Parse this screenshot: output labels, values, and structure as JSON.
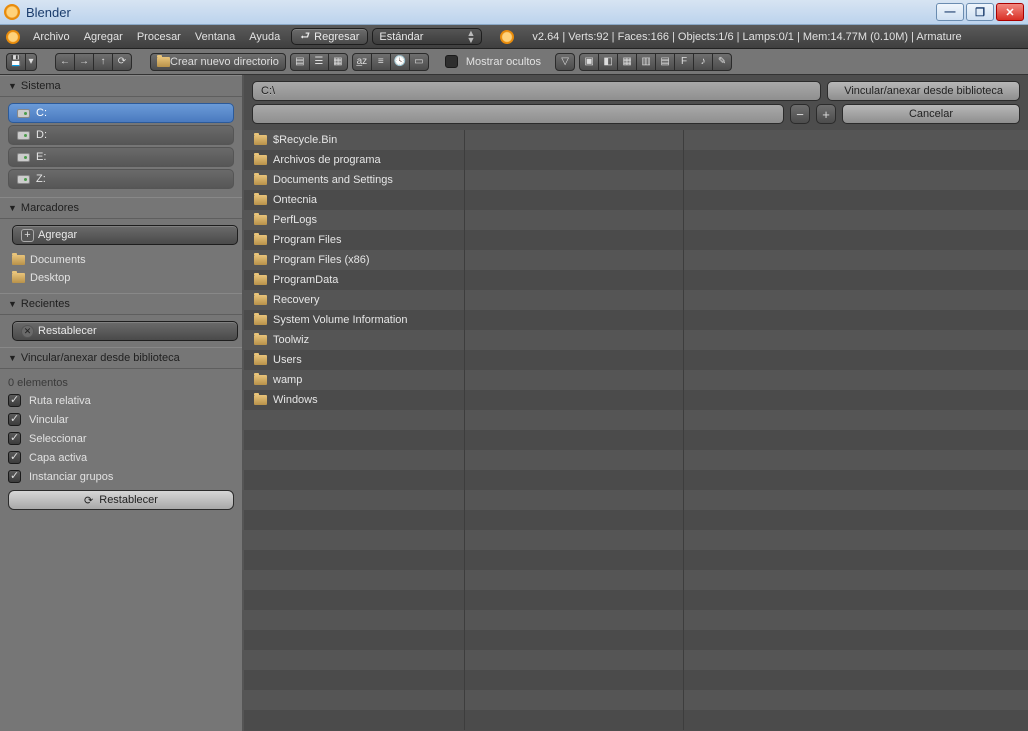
{
  "title": "Blender",
  "menus": [
    "Archivo",
    "Agregar",
    "Procesar",
    "Ventana",
    "Ayuda"
  ],
  "back_btn": "Regresar",
  "layout_dropdown": "Estándar",
  "status": "v2.64 | Verts:92 | Faces:166 | Objects:1/6 | Lamps:0/1 | Mem:14.77M (0.10M) | Armature",
  "toolbar": {
    "new_dir": "Crear nuevo directorio",
    "show_hidden": "Mostrar ocultos"
  },
  "path": "C:\\",
  "filename": "",
  "action_btn": "Vincular/anexar desde biblioteca",
  "cancel_btn": "Cancelar",
  "sidebar": {
    "system_hdr": "Sistema",
    "drives": [
      "C:",
      "D:",
      "E:",
      "Z:"
    ],
    "bookmarks_hdr": "Marcadores",
    "add_bookmark": "Agregar",
    "bookmarks": [
      "Documents",
      "Desktop"
    ],
    "recent_hdr": "Recientes",
    "reset": "Restablecer",
    "link_hdr": "Vincular/anexar desde biblioteca",
    "elements_note": "0 elementos",
    "opts": [
      "Ruta relativa",
      "Vincular",
      "Seleccionar",
      "Capa activa",
      "Instanciar grupos"
    ],
    "reset2": "Restablecer"
  },
  "files": [
    "$Recycle.Bin",
    "Archivos de programa",
    "Documents and Settings",
    "Ontecnia",
    "PerfLogs",
    "Program Files",
    "Program Files (x86)",
    "ProgramData",
    "Recovery",
    "System Volume Information",
    "Toolwiz",
    "Users",
    "wamp",
    "Windows"
  ]
}
